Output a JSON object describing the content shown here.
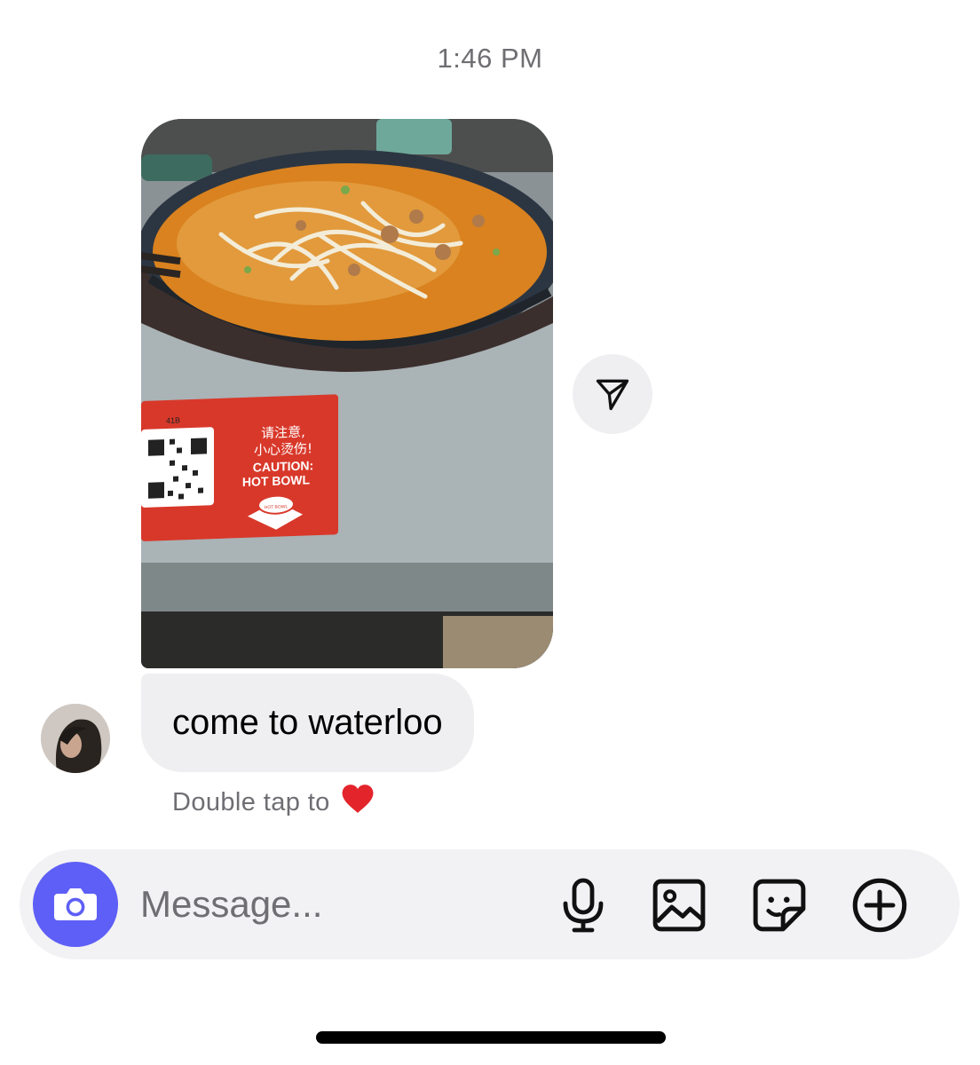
{
  "chat": {
    "timestamp": "1:46 PM",
    "messages": [
      {
        "type": "photo",
        "content": "photo-of-noodle-soup",
        "sticker_text": {
          "line1": "请注意,",
          "line2": "小心烫伤!",
          "line3": "CAUTION:",
          "line4": "HOT BOWL",
          "code": "41B",
          "bowl_label": "HOT BOWL"
        }
      },
      {
        "type": "text",
        "text": "come to waterloo"
      }
    ],
    "reaction_hint": {
      "text": "Double tap to",
      "emoji": "❤️"
    }
  },
  "composer": {
    "placeholder": "Message...",
    "value": "",
    "camera_icon": "camera-icon",
    "tools": [
      "microphone-icon",
      "gallery-icon",
      "sticker-icon",
      "plus-circle-icon"
    ]
  },
  "colors": {
    "accent": "#5e5ff6",
    "bubble": "#efeff1",
    "composer_bg": "#f2f2f4",
    "muted_text": "#6e6e73"
  }
}
